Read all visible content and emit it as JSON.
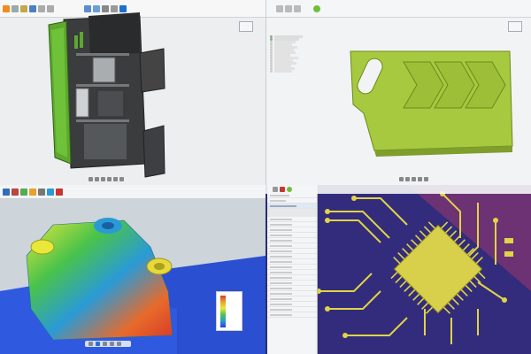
{
  "colors": {
    "accent_green": "#8bc34a",
    "body_green": "#9bc93b",
    "dark_panel": "#2f3133",
    "pcb_yellow": "#e0d545",
    "pcb_bg": "#2a2f6e",
    "brand_blue": "#1b6fd1"
  },
  "icons": [
    "folder-icon",
    "save-icon",
    "undo-icon",
    "redo-icon",
    "check-icon",
    "gear-icon",
    "play-icon",
    "pause-icon",
    "home-icon"
  ],
  "legend": {
    "ticks": [
      "",
      "",
      "",
      "",
      "",
      ""
    ]
  }
}
